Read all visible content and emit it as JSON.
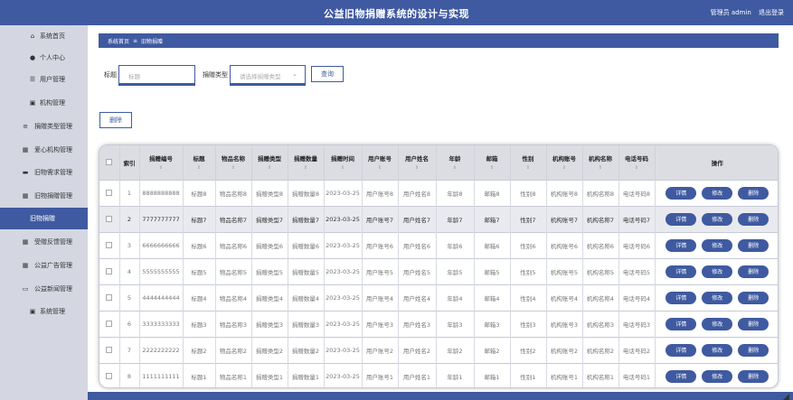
{
  "header": {
    "title": "公益旧物捐赠系统的设计与实现",
    "user_label": "管理员 admin",
    "logout_label": "退出登录"
  },
  "sidebar": {
    "items": [
      {
        "label": "系统首页",
        "icon": "home-icon",
        "active": false
      },
      {
        "label": "个人中心",
        "icon": "person-icon",
        "active": false
      },
      {
        "label": "用户管理",
        "icon": "sliders-icon",
        "active": false
      },
      {
        "label": "机构管理",
        "icon": "clipboard-icon",
        "active": false
      },
      {
        "label": "捐赠类型管理",
        "icon": "list-icon",
        "active": false
      },
      {
        "label": "爱心机构管理",
        "icon": "grid-icon",
        "active": false
      },
      {
        "label": "旧物需求管理",
        "icon": "card-icon",
        "active": false
      },
      {
        "label": "旧物捐赠管理",
        "icon": "grid-icon",
        "active": false
      },
      {
        "label": "旧物捐赠",
        "icon": "",
        "active": true
      },
      {
        "label": "受赠反馈管理",
        "icon": "grid-icon",
        "active": false
      },
      {
        "label": "公益广告管理",
        "icon": "grid-icon",
        "active": false
      },
      {
        "label": "公益新闻管理",
        "icon": "monitor-icon",
        "active": false
      },
      {
        "label": "系统管理",
        "icon": "clipboard-icon",
        "active": false
      }
    ]
  },
  "breadcrumb": {
    "home": "系统首页",
    "separator": "≡",
    "current": "旧物捐赠"
  },
  "search": {
    "title_label": "标题",
    "title_placeholder": "标题",
    "type_label": "捐赠类型",
    "type_placeholder": "请选择捐赠类型",
    "query_button": "查询"
  },
  "toolbar": {
    "delete_button": "删除"
  },
  "table": {
    "columns": [
      "索引",
      "捐赠编号",
      "标题",
      "物品名称",
      "捐赠类型",
      "捐赠数量",
      "捐赠时间",
      "用户账号",
      "用户姓名",
      "年龄",
      "邮箱",
      "性别",
      "机构账号",
      "机构名称",
      "电话号码",
      "操作"
    ],
    "sortable": [
      false,
      true,
      true,
      true,
      true,
      true,
      true,
      true,
      true,
      true,
      true,
      true,
      true,
      true,
      true,
      false
    ],
    "rows": [
      [
        "1",
        "8888888888",
        "标题8",
        "物品名称8",
        "捐赠类型8",
        "捐赠数量8",
        "2023-03-25",
        "用户账号8",
        "用户姓名8",
        "年龄8",
        "邮箱8",
        "性别8",
        "机构账号8",
        "机构名称8",
        "电话号码8"
      ],
      [
        "2",
        "7777777777",
        "标题7",
        "物品名称7",
        "捐赠类型7",
        "捐赠数量7",
        "2023-03-25",
        "用户账号7",
        "用户姓名7",
        "年龄7",
        "邮箱7",
        "性别7",
        "机构账号7",
        "机构名称7",
        "电话号码7"
      ],
      [
        "3",
        "6666666666",
        "标题6",
        "物品名称6",
        "捐赠类型6",
        "捐赠数量6",
        "2023-03-25",
        "用户账号6",
        "用户姓名6",
        "年龄6",
        "邮箱6",
        "性别6",
        "机构账号6",
        "机构名称6",
        "电话号码6"
      ],
      [
        "4",
        "5555555555",
        "标题5",
        "物品名称5",
        "捐赠类型5",
        "捐赠数量5",
        "2023-03-25",
        "用户账号5",
        "用户姓名5",
        "年龄5",
        "邮箱5",
        "性别5",
        "机构账号5",
        "机构名称5",
        "电话号码5"
      ],
      [
        "5",
        "4444444444",
        "标题4",
        "物品名称4",
        "捐赠类型4",
        "捐赠数量4",
        "2023-03-25",
        "用户账号4",
        "用户姓名4",
        "年龄4",
        "邮箱4",
        "性别4",
        "机构账号4",
        "机构名称4",
        "电话号码4"
      ],
      [
        "6",
        "3333333333",
        "标题3",
        "物品名称3",
        "捐赠类型3",
        "捐赠数量3",
        "2023-03-25",
        "用户账号3",
        "用户姓名3",
        "年龄3",
        "邮箱3",
        "性别3",
        "机构账号3",
        "机构名称3",
        "电话号码3"
      ],
      [
        "7",
        "2222222222",
        "标题2",
        "物品名称2",
        "捐赠类型2",
        "捐赠数量2",
        "2023-03-25",
        "用户账号2",
        "用户姓名2",
        "年龄2",
        "邮箱2",
        "性别2",
        "机构账号2",
        "机构名称2",
        "电话号码2"
      ],
      [
        "8",
        "1111111111",
        "标题1",
        "物品名称1",
        "捐赠类型1",
        "捐赠数量1",
        "2023-03-25",
        "用户账号1",
        "用户姓名1",
        "年龄1",
        "邮箱1",
        "性别1",
        "机构账号1",
        "机构名称1",
        "电话号码1"
      ]
    ],
    "actions": [
      "详情",
      "修改",
      "删除"
    ],
    "highlighted_row": 2
  },
  "colors": {
    "primary": "#3f5aa0",
    "sidebar_bg": "#d4d7e1",
    "header_row_bg": "#dcdde2",
    "highlight_row_bg": "#e9eaef"
  }
}
